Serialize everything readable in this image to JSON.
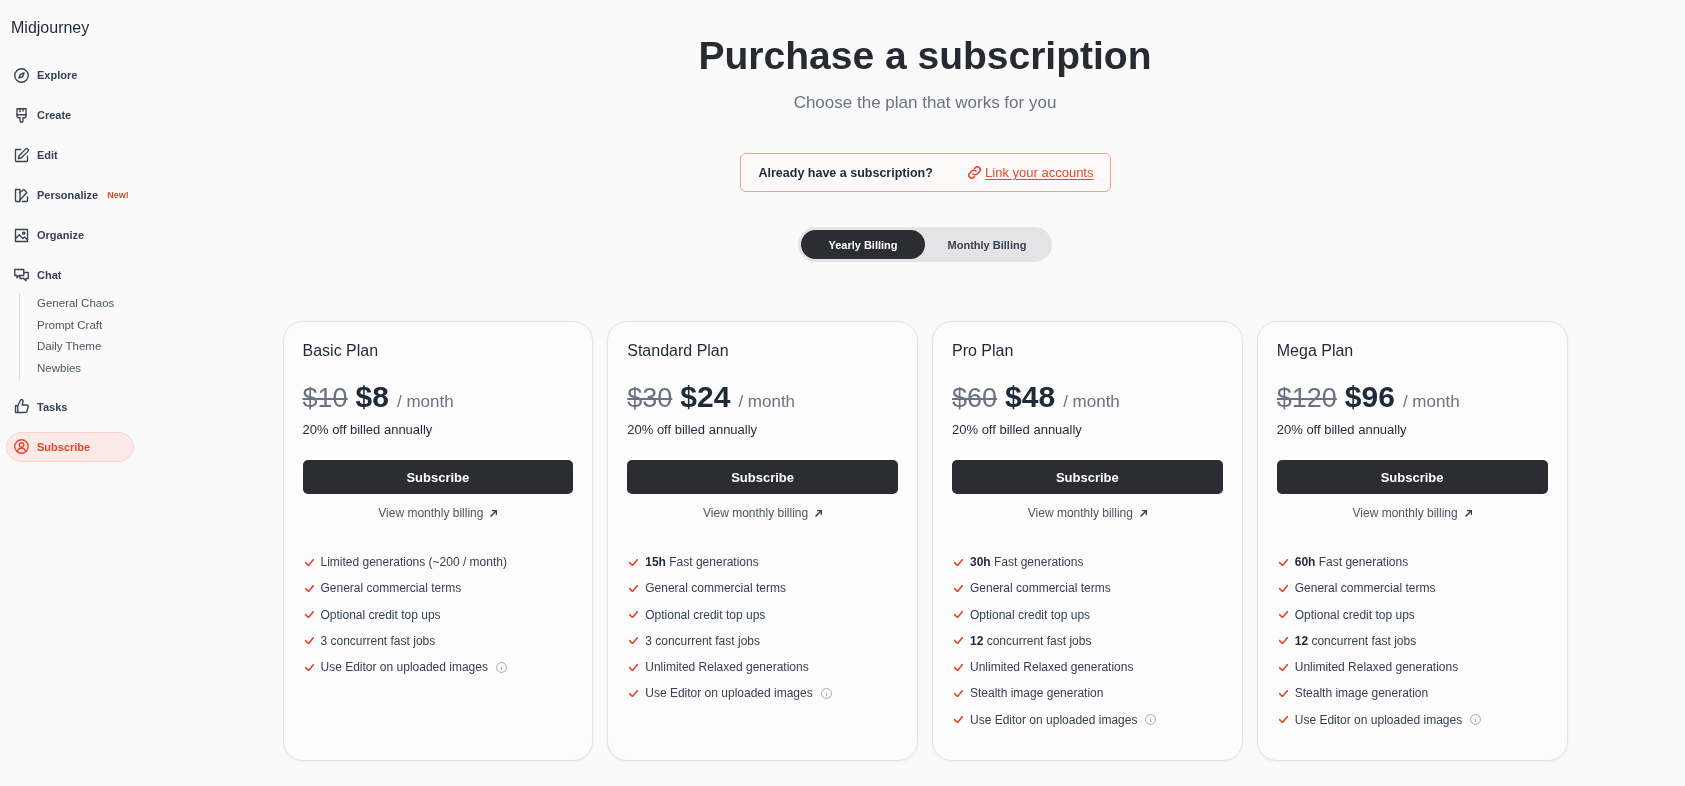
{
  "sidebar": {
    "brand": "Midjourney",
    "items": [
      {
        "label": "Explore",
        "selected": false
      },
      {
        "label": "Create",
        "selected": false
      },
      {
        "label": "Edit",
        "selected": false
      },
      {
        "label": "Personalize",
        "selected": false,
        "badge": "New!"
      },
      {
        "label": "Organize",
        "selected": false
      },
      {
        "label": "Chat",
        "selected": false,
        "children": [
          {
            "label": "General Chaos",
            "selected": false
          },
          {
            "label": "Prompt Craft",
            "selected": false
          },
          {
            "label": "Daily Theme",
            "selected": false
          },
          {
            "label": "Newbies",
            "selected": false
          }
        ]
      },
      {
        "label": "Tasks",
        "selected": false
      },
      {
        "label": "Subscribe",
        "selected": true
      }
    ]
  },
  "header": {
    "title": "Purchase a subscription",
    "subtitle": "Choose the plan that works for you"
  },
  "account_link": {
    "text": "Already have a subscription?",
    "link": "Link your accounts"
  },
  "billing_toggle": [
    {
      "label": "Yearly Billing",
      "selected": true
    },
    {
      "label": "Monthly Billing",
      "selected": false
    }
  ],
  "plans": [
    {
      "name": "Basic Plan",
      "old_price": "$10",
      "price": "$8",
      "period": "/ month",
      "discount": "20% off billed annually",
      "button": "Subscribe",
      "link": "View monthly billing",
      "features": [
        {
          "text": "Limited generations (~200 / month)",
          "info": false
        },
        {
          "text": "General commercial terms",
          "info": false
        },
        {
          "text": "Optional credit top ups",
          "info": false
        },
        {
          "text": "3 concurrent fast jobs",
          "info": false
        },
        {
          "text": "Use Editor on uploaded images",
          "info": true
        }
      ]
    },
    {
      "name": "Standard Plan",
      "old_price": "$30",
      "price": "$24",
      "period": "/ month",
      "discount": "20% off billed annually",
      "button": "Subscribe",
      "link": "View monthly billing",
      "features": [
        {
          "text": "**15h** Fast generations",
          "info": false
        },
        {
          "text": "General commercial terms",
          "info": false
        },
        {
          "text": "Optional credit top ups",
          "info": false
        },
        {
          "text": "3 concurrent fast jobs",
          "info": false
        },
        {
          "text": "Unlimited Relaxed generations",
          "info": false
        },
        {
          "text": "Use Editor on uploaded images",
          "info": true
        }
      ]
    },
    {
      "name": "Pro Plan",
      "old_price": "$60",
      "price": "$48",
      "period": "/ month",
      "discount": "20% off billed annually",
      "button": "Subscribe",
      "link": "View monthly billing",
      "features": [
        {
          "text": "**30h** Fast generations",
          "info": false
        },
        {
          "text": "General commercial terms",
          "info": false
        },
        {
          "text": "Optional credit top ups",
          "info": false
        },
        {
          "text": "**12** concurrent fast jobs",
          "info": false
        },
        {
          "text": "Unlimited Relaxed generations",
          "info": false
        },
        {
          "text": "Stealth image generation",
          "info": false
        },
        {
          "text": "Use Editor on uploaded images",
          "info": true
        }
      ]
    },
    {
      "name": "Mega Plan",
      "old_price": "$120",
      "price": "$96",
      "period": "/ month",
      "discount": "20% off billed annually",
      "button": "Subscribe",
      "link": "View monthly billing",
      "features": [
        {
          "text": "**60h** Fast generations",
          "info": false
        },
        {
          "text": "General commercial terms",
          "info": false
        },
        {
          "text": "Optional credit top ups",
          "info": false
        },
        {
          "text": "**12** concurrent fast jobs",
          "info": false
        },
        {
          "text": "Unlimited Relaxed generations",
          "info": false
        },
        {
          "text": "Stealth image generation",
          "info": false
        },
        {
          "text": "Use Editor on uploaded images",
          "info": true
        }
      ]
    }
  ]
}
